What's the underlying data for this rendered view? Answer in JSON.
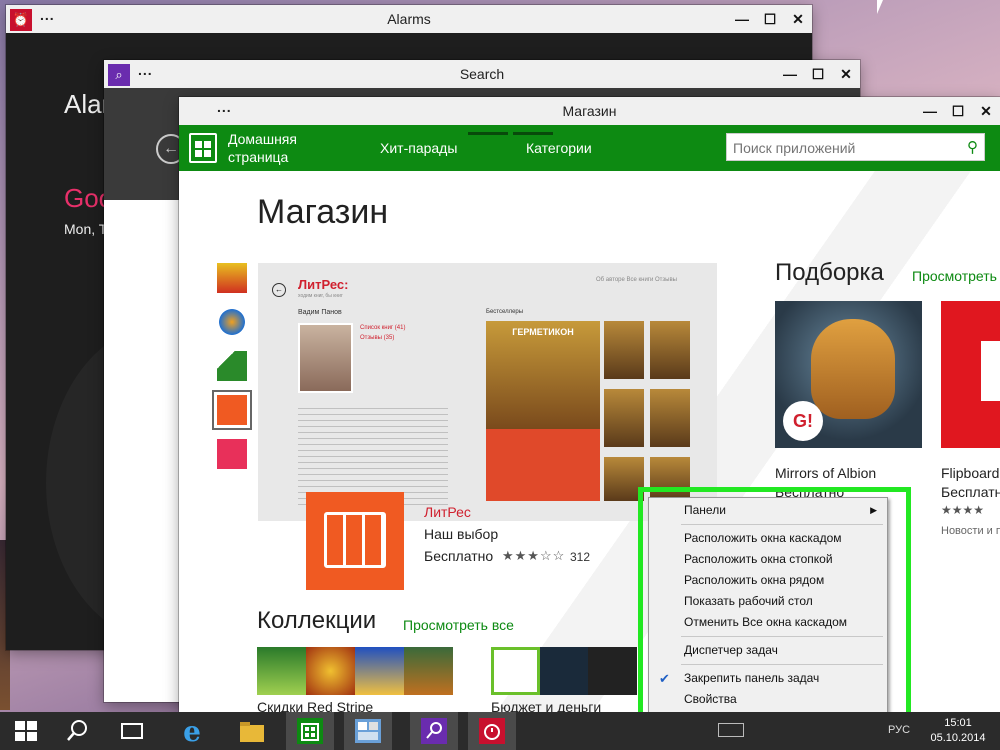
{
  "alarms_window": {
    "title": "Alarms",
    "heading": "Alar",
    "greeting": "Goo",
    "date": "Mon, T",
    "dots": "...",
    "icon": "alarm-clock-icon"
  },
  "search_window": {
    "title": "Search",
    "dots": "...",
    "icon": "search-icon"
  },
  "store_window": {
    "title": "Магазин",
    "dots": "...",
    "nav": {
      "home": "Домашняя страница",
      "charts": "Хит-парады",
      "categories": "Категории"
    },
    "search_placeholder": "Поиск приложений",
    "page_title": "Магазин",
    "featured": {
      "app_name": "ЛитРес",
      "choice": "Наш выбор",
      "price": "Бесплатно",
      "stars": "★★★☆☆",
      "rating_count": "312",
      "screenshot": {
        "logo": "ЛитРес:",
        "tagline": "ходим книг, бы книг",
        "author": "Вадим Панов",
        "links": [
          "Список книг (41)",
          "Отзывы (35)"
        ],
        "bestsellers": "Бестселлеры",
        "cover_title": "ГЕРМЕТИКОН",
        "tabs": "Об авторе   Все книги   Отзывы"
      }
    },
    "collections": {
      "title": "Коллекции",
      "more": "Просмотреть все",
      "label_a": "Скидки Red Stripe",
      "label_b": "Бюджет и деньги"
    },
    "picks": {
      "title": "Подборка",
      "more": "Просмотреть",
      "item1_name": "Mirrors of Albion",
      "item1_price": "Бесплатно",
      "item1_badge": "G!",
      "item2_name": "Flipboard",
      "item2_price": "Бесплатн",
      "item2_stars": "★★★★",
      "item2_category": "Новости и п"
    }
  },
  "context_menu": {
    "items": [
      "Панели",
      "Расположить окна каскадом",
      "Расположить окна стопкой",
      "Расположить окна рядом",
      "Показать рабочий стол",
      "Отменить Все окна каскадом",
      "Диспетчер задач",
      "Закрепить панель задач",
      "Свойства"
    ],
    "highlight_color": "#22e822"
  },
  "taskbar": {
    "language": "РУС",
    "time": "15:01",
    "date": "05.10.2014"
  },
  "window_controls": {
    "minimize": "—",
    "maximize": "☐",
    "close": "✕"
  },
  "colors": {
    "store_green": "#0d8a12",
    "alarm_red": "#c8102e",
    "litres_orange": "#f05a22"
  }
}
